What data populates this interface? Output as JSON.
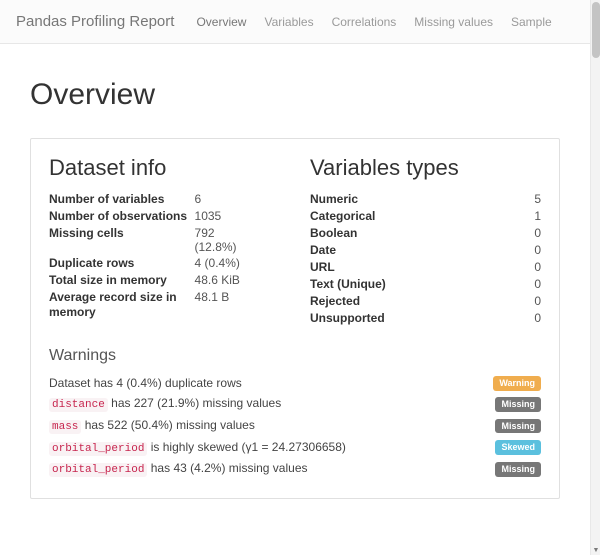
{
  "nav": {
    "brand": "Pandas Profiling Report",
    "links": [
      "Overview",
      "Variables",
      "Correlations",
      "Missing values",
      "Sample"
    ],
    "active": 0
  },
  "section_title": "Overview",
  "dataset_info": {
    "title": "Dataset info",
    "rows": [
      {
        "label": "Number of variables",
        "value": "6"
      },
      {
        "label": "Number of observations",
        "value": "1035"
      },
      {
        "label": "Missing cells",
        "value": "792 (12.8%)"
      },
      {
        "label": "Duplicate rows",
        "value": "4 (0.4%)"
      },
      {
        "label": "Total size in memory",
        "value": "48.6 KiB"
      },
      {
        "label": "Average record size in memory",
        "value": "48.1 B"
      }
    ]
  },
  "variable_types": {
    "title": "Variables types",
    "rows": [
      {
        "label": "Numeric",
        "value": "5"
      },
      {
        "label": "Categorical",
        "value": "1"
      },
      {
        "label": "Boolean",
        "value": "0"
      },
      {
        "label": "Date",
        "value": "0"
      },
      {
        "label": "URL",
        "value": "0"
      },
      {
        "label": "Text (Unique)",
        "value": "0"
      },
      {
        "label": "Rejected",
        "value": "0"
      },
      {
        "label": "Unsupported",
        "value": "0"
      }
    ]
  },
  "warnings": {
    "title": "Warnings",
    "items": [
      {
        "prefix": "Dataset has 4 (0.4%) duplicate rows",
        "var": "",
        "suffix": "",
        "badge": "Warning",
        "badge_kind": "warning"
      },
      {
        "prefix": "",
        "var": "distance",
        "suffix": " has 227 (21.9%) missing values",
        "badge": "Missing",
        "badge_kind": "missing"
      },
      {
        "prefix": "",
        "var": "mass",
        "suffix": " has 522 (50.4%) missing values",
        "badge": "Missing",
        "badge_kind": "missing"
      },
      {
        "prefix": "",
        "var": "orbital_period",
        "suffix": " is highly skewed (γ1 = 24.27306658)",
        "badge": "Skewed",
        "badge_kind": "skewed"
      },
      {
        "prefix": "",
        "var": "orbital_period",
        "suffix": " has 43 (4.2%) missing values",
        "badge": "Missing",
        "badge_kind": "missing"
      }
    ]
  }
}
